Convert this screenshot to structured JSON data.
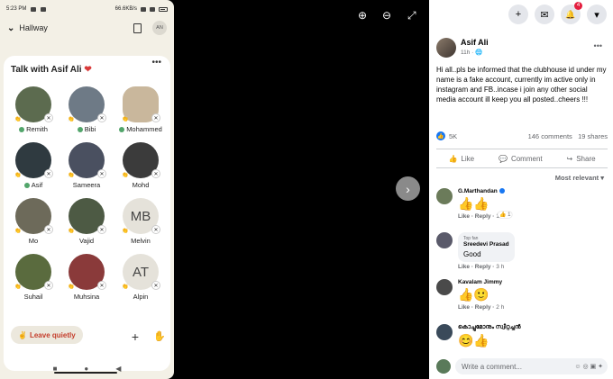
{
  "phone": {
    "status_time": "5:23 PM",
    "status_right": "66.6KB/s",
    "battery": "",
    "hallway_label": "Hallway",
    "avatar_initials": "AN",
    "room_title": "Talk with Asif Ali",
    "room_heart": "❤",
    "room_menu": "•••",
    "speakers": [
      {
        "name": "Remith",
        "moderator": true,
        "initials": "",
        "color": "#5c6b4f"
      },
      {
        "name": "Bibi",
        "moderator": true,
        "initials": "",
        "color": "#6e7a86"
      },
      {
        "name": "Mohammed",
        "moderator": true,
        "initials": "",
        "color": "#c9b79c"
      },
      {
        "name": "Asif",
        "moderator": true,
        "initials": "",
        "color": "#2f3a40"
      },
      {
        "name": "Sameera",
        "moderator": false,
        "initials": "",
        "color": "#4a5060"
      },
      {
        "name": "Mohd",
        "moderator": false,
        "initials": "",
        "color": "#3b3b3b"
      },
      {
        "name": "Mo",
        "moderator": false,
        "initials": "",
        "color": "#6d6a5a"
      },
      {
        "name": "Vajid",
        "moderator": false,
        "initials": "",
        "color": "#4d5a44"
      },
      {
        "name": "Melvin",
        "moderator": false,
        "initials": "MB",
        "color": "#e5e2da"
      },
      {
        "name": "Suhail",
        "moderator": false,
        "initials": "",
        "color": "#5a6b3e"
      },
      {
        "name": "Muhsina",
        "moderator": false,
        "initials": "",
        "color": "#8a3a3a"
      },
      {
        "name": "Alpin",
        "moderator": false,
        "initials": "AT",
        "color": "#e5e2da"
      }
    ],
    "leave_label": "Leave quietly",
    "leave_icon": "✌",
    "plus_icon": "+",
    "hand_icon": "✋",
    "nav": {
      "square": "■",
      "circle": "●",
      "back": "◀"
    }
  },
  "viewer": {
    "zoom_in": "⊕",
    "zoom_out": "⊖",
    "fullscreen": "⤢",
    "next": "›"
  },
  "fb": {
    "topbar": {
      "plus": "+",
      "messenger": "✉",
      "bell": "🔔",
      "bell_badge": "4",
      "caret": "▾"
    },
    "author": "Asif Ali",
    "post_time": "11h · 🌐",
    "post_menu": "•••",
    "post_text": "Hi all..pls be informed that the clubhouse id under my name is a fake account, currently im active only in instagram and FB..incase i join any other social media account ill keep you all posted..cheers !!!",
    "reactions": "5K",
    "comments_count": "146 comments",
    "shares_count": "19 shares",
    "like_label": "Like",
    "comment_label": "Comment",
    "share_label": "Share",
    "sort_label": "Most relevant ▾",
    "comments": [
      {
        "name": "G.Marthandan",
        "verified": true,
        "toptag": "",
        "text": "",
        "emoji": "👍👍",
        "react_count": "1",
        "time": "11 m"
      },
      {
        "name": "Sreedevi Prasad",
        "verified": false,
        "toptag": "Top fan",
        "text": "Good",
        "emoji": "",
        "react_count": "",
        "time": "3 h"
      },
      {
        "name": "Kavalam Jimmy",
        "verified": false,
        "toptag": "",
        "text": "",
        "emoji": "👍🙂",
        "react_count": "",
        "time": "2 h"
      },
      {
        "name": "കൊച്ചുമോനും സ്വീറ്റച്ചൻ",
        "verified": false,
        "toptag": "",
        "text": "",
        "emoji": "😊👍",
        "react_count": "",
        "time": ""
      }
    ],
    "comment_like": "Like",
    "comment_reply": "Reply",
    "write_placeholder": "Write a comment...",
    "write_icons": "☺ ◎ ▣ ✦"
  }
}
